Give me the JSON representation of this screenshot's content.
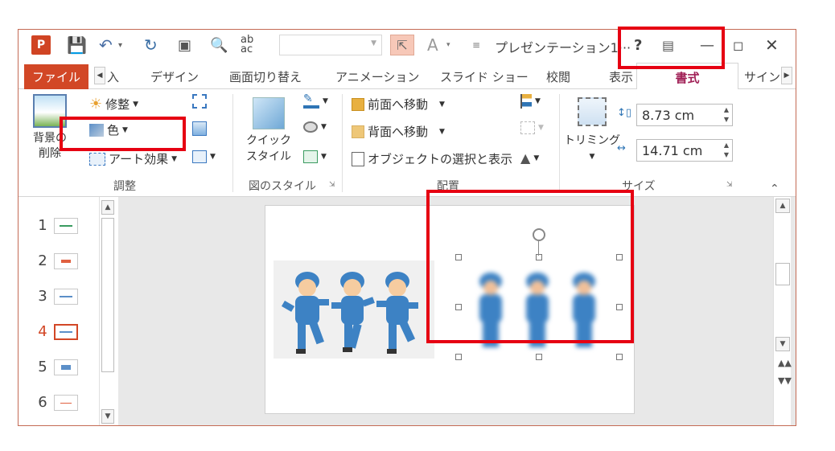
{
  "titlebar": {
    "logo_label": "P",
    "doc_title": "プレゼンテーション1···",
    "help": "?",
    "font_combo_value": ""
  },
  "tabs": {
    "file": "ファイル",
    "insert_partial": "入",
    "design": "デザイン",
    "transitions": "画面切り替え",
    "animations": "アニメーション",
    "slideshow": "スライド ショー",
    "review": "校閲",
    "view": "表示",
    "format": "書式",
    "addin_partial": "サインイ"
  },
  "ribbon": {
    "adjust": {
      "label": "調整",
      "remove_bg_line1": "背景の",
      "remove_bg_line2": "削除",
      "corrections": "修整",
      "color": "色",
      "art_effects": "アート効果"
    },
    "styles": {
      "label": "図のスタイル",
      "quick_styles_line1": "クイック",
      "quick_styles_line2": "スタイル"
    },
    "arrange": {
      "label": "配置",
      "bring_forward": "前面へ移動",
      "send_backward": "背面へ移動",
      "selection_pane": "オブジェクトの選択と表示"
    },
    "size": {
      "label": "サイズ",
      "crop": "トリミング",
      "height": "8.73 cm",
      "width": "14.71 cm"
    }
  },
  "slides": [
    {
      "num": "1"
    },
    {
      "num": "2"
    },
    {
      "num": "3"
    },
    {
      "num": "4",
      "active": true
    },
    {
      "num": "5"
    },
    {
      "num": "6"
    }
  ],
  "colors": {
    "accent": "#d24726",
    "format_tab": "#a02056",
    "highlight": "#e60012",
    "shirt": "#3d82c4"
  }
}
